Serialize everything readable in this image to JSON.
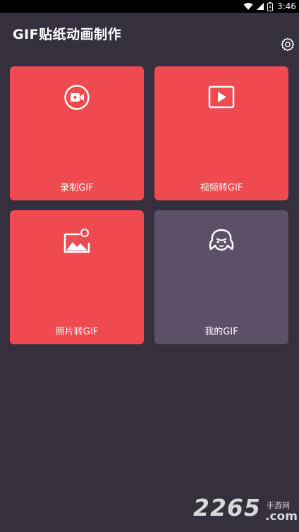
{
  "status_bar": {
    "time": "3:46"
  },
  "header": {
    "title": "GIF贴纸动画制作"
  },
  "tiles": [
    {
      "label": "录制GIF",
      "icon": "video-camera-icon",
      "color": "#ee4a50"
    },
    {
      "label": "视频转GIF",
      "icon": "video-play-icon",
      "color": "#ee4a50"
    },
    {
      "label": "照片转GIF",
      "icon": "image-convert-icon",
      "color": "#ee4a50"
    },
    {
      "label": "我的GIF",
      "icon": "avatar-icon",
      "color": "#5c5069"
    }
  ],
  "watermark": {
    "number": "2265",
    "text_cn": "手游网",
    "domain": ".com"
  },
  "colors": {
    "background": "#352f3e",
    "accent": "#ee4a50",
    "secondary": "#5c5069"
  }
}
